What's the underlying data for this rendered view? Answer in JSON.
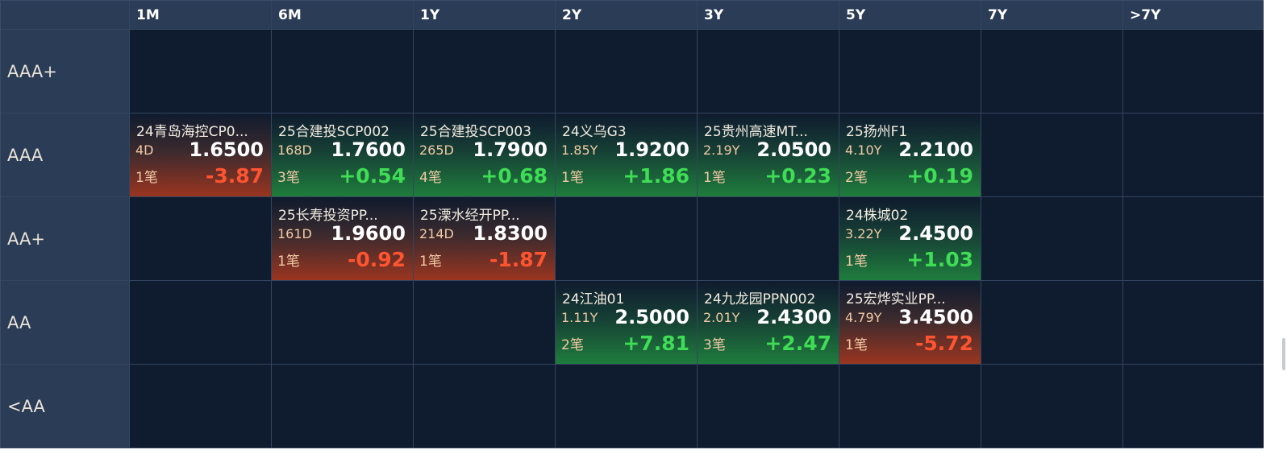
{
  "columns": [
    "1M",
    "6M",
    "1Y",
    "2Y",
    "3Y",
    "5Y",
    "7Y",
    ">7Y"
  ],
  "rows": [
    "AAA+",
    "AAA",
    "AA+",
    "AA",
    "<AA"
  ],
  "colors": {
    "up": "#3fdc55",
    "down": "#ff5430",
    "background": "#0f1b2e",
    "header": "#2b3c56"
  },
  "cells": {
    "r1c0": {
      "name": "24青岛海控CP0...",
      "term": "4D",
      "price": "1.6500",
      "count": "1笔",
      "change": "-3.87",
      "dir": "down"
    },
    "r1c1": {
      "name": "25合建投SCP002",
      "term": "168D",
      "price": "1.7600",
      "count": "3笔",
      "change": "+0.54",
      "dir": "up"
    },
    "r1c2": {
      "name": "25合建投SCP003",
      "term": "265D",
      "price": "1.7900",
      "count": "4笔",
      "change": "+0.68",
      "dir": "up"
    },
    "r1c3": {
      "name": "24义乌G3",
      "term": "1.85Y",
      "price": "1.9200",
      "count": "1笔",
      "change": "+1.86",
      "dir": "up"
    },
    "r1c4": {
      "name": "25贵州高速MT...",
      "term": "2.19Y",
      "price": "2.0500",
      "count": "1笔",
      "change": "+0.23",
      "dir": "up"
    },
    "r1c5": {
      "name": "25扬州F1",
      "term": "4.10Y",
      "price": "2.2100",
      "count": "2笔",
      "change": "+0.19",
      "dir": "up"
    },
    "r2c1": {
      "name": "25长寿投资PP...",
      "term": "161D",
      "price": "1.9600",
      "count": "1笔",
      "change": "-0.92",
      "dir": "down"
    },
    "r2c2": {
      "name": "25溧水经开PP...",
      "term": "214D",
      "price": "1.8300",
      "count": "1笔",
      "change": "-1.87",
      "dir": "down"
    },
    "r2c5": {
      "name": "24株城02",
      "term": "3.22Y",
      "price": "2.4500",
      "count": "1笔",
      "change": "+1.03",
      "dir": "up"
    },
    "r3c3": {
      "name": "24江油01",
      "term": "1.11Y",
      "price": "2.5000",
      "count": "2笔",
      "change": "+7.81",
      "dir": "up"
    },
    "r3c4": {
      "name": "24九龙园PPN002",
      "term": "2.01Y",
      "price": "2.4300",
      "count": "3笔",
      "change": "+2.47",
      "dir": "up"
    },
    "r3c5": {
      "name": "25宏烨实业PP...",
      "term": "4.79Y",
      "price": "3.4500",
      "count": "1笔",
      "change": "-5.72",
      "dir": "down"
    }
  }
}
